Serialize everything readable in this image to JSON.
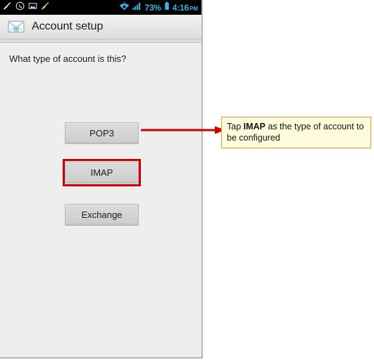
{
  "phone": {
    "status_bar": {
      "notification_icons": [
        "broom-icon",
        "whatsapp-icon",
        "gallery-image-icon",
        "broom-icon"
      ],
      "wifi_icon": "wifi-icon",
      "signal_icon": "signal-bars-icon",
      "battery_percent": "73%",
      "battery_icon": "battery-icon",
      "time": "4:16",
      "time_period": "PM",
      "accent_color": "#39b4e6"
    },
    "action_bar": {
      "app_icon": "email-envelope-icon",
      "title": "Account setup"
    },
    "content": {
      "question": "What type of account is this?",
      "account_type_buttons": [
        {
          "label": "POP3"
        },
        {
          "label": "IMAP"
        },
        {
          "label": "Exchange"
        }
      ]
    }
  },
  "annotation": {
    "highlight_color": "#cc0000",
    "arrow_color": "#cc0000",
    "callout": {
      "text_before": "Tap ",
      "emphasis": "IMAP",
      "text_after": " as the type of account to be configured",
      "background_color": "#fdfbdc",
      "border_color": "#e2993d"
    }
  }
}
